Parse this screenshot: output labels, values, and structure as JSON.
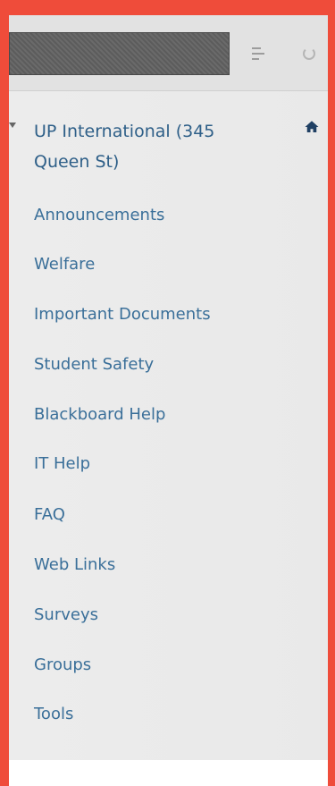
{
  "course_menu": {
    "title": "UP International (345 Queen St)",
    "items": [
      "Announcements",
      "Welfare",
      "Important Documents",
      "Student Safety",
      "Blackboard Help",
      "IT Help",
      "FAQ",
      "Web Links",
      "Surveys",
      "Groups",
      "Tools"
    ]
  },
  "colors": {
    "frame": "#ef4c3a",
    "link": "#3a6f99",
    "title": "#2e5f88"
  },
  "icons": [
    "sort-icon",
    "refresh-icon",
    "home-icon",
    "expand-arrow-icon"
  ]
}
